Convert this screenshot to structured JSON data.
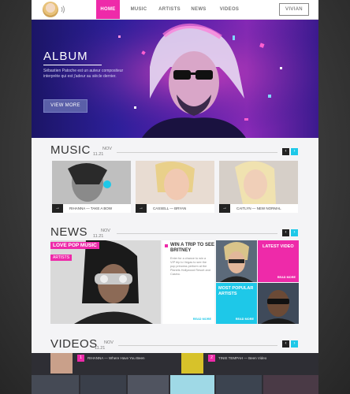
{
  "nav": {
    "items": [
      "HOME",
      "MUSIC",
      "ARTISTS",
      "NEWS",
      "VIDEOS"
    ],
    "active": "HOME",
    "user_label": "VIVIAN"
  },
  "hero": {
    "title": "ALBUM",
    "description": "Sébastien Patoche est un auteur compositeur interprète qui est j'adeur au siècle dernier.",
    "button_label": "VIEW MORE"
  },
  "music": {
    "title": "MUSIC",
    "date_month": "NOV",
    "date_day": "11.21",
    "cards": [
      {
        "caption": "RIHANNA — TAKE A BOW"
      },
      {
        "caption": "CASSELL — BRYAN"
      },
      {
        "caption": "CAITLYN — NEW NORMAL"
      }
    ]
  },
  "news": {
    "title": "NEWS",
    "date_month": "NOV",
    "date_day": "11.21",
    "feature_tag": "LOVE POP MUSIC",
    "feature_sub": "ARTISTS",
    "article_title": "WIN A TRIP TO SEE BRITNEY",
    "article_body": "Enter for a chance to win a VIP trip to Vegas to see the pop princess perform at the Planets Hollywood Resort and Casino.",
    "read_more": "READ MORE",
    "latest_video": "LATEST VIDEO",
    "most_popular": "MOST POPULAR ARTISTS"
  },
  "videos": {
    "title": "VIDEOS",
    "date_month": "NOV",
    "date_day": "11.21",
    "items": [
      {
        "num": "1",
        "label": "RIHANNA — Where Have You Been"
      },
      {
        "num": "2",
        "label": "TINIE TEMPAH — Been Video"
      }
    ]
  },
  "colors": {
    "pink": "#ee2aa9",
    "cyan": "#1ec8e8",
    "hero_purple": "#2d1f9a"
  }
}
